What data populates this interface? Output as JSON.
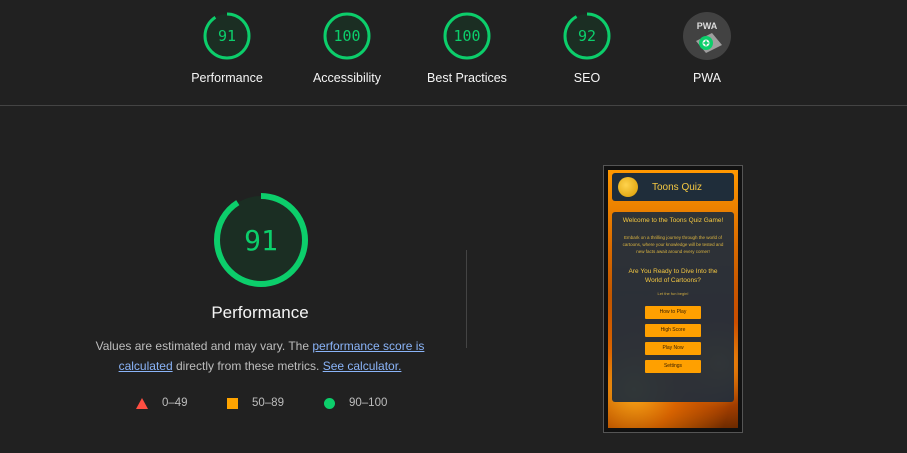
{
  "colors": {
    "pass": "#0cce6b",
    "average": "#ffa400",
    "fail": "#ff4e42",
    "link": "#8ab4f8"
  },
  "categories": [
    {
      "label": "Performance",
      "score": "91",
      "fraction": 0.91
    },
    {
      "label": "Accessibility",
      "score": "100",
      "fraction": 1.0
    },
    {
      "label": "Best Practices",
      "score": "100",
      "fraction": 1.0
    },
    {
      "label": "SEO",
      "score": "92",
      "fraction": 0.92
    },
    {
      "label": "PWA",
      "badge_icon": "pwa-badge-icon"
    }
  ],
  "performance": {
    "score": "91",
    "fraction": 0.91,
    "title": "Performance",
    "desc_prefix": "Values are estimated and may vary. The ",
    "link1": "performance score is calculated",
    "desc_mid": " directly from these metrics. ",
    "link2": "See calculator."
  },
  "legend": [
    {
      "shape": "triangle",
      "label": "0–49"
    },
    {
      "shape": "square",
      "label": "50–89"
    },
    {
      "shape": "circle",
      "label": "90–100"
    }
  ],
  "screenshot": {
    "app_title": "Toons Quiz",
    "welcome": "Welcome to the Toons Quiz Game!",
    "intro": "Embark on a thrilling journey through the world of cartoons, where your knowledge will be tested and new facts await around every corner!",
    "question": "Are You Ready to Dive Into the World of Cartoons?",
    "sub": "Let the fun begin!",
    "buttons": [
      "How to Play",
      "High Score",
      "Play Now",
      "Settings"
    ]
  }
}
